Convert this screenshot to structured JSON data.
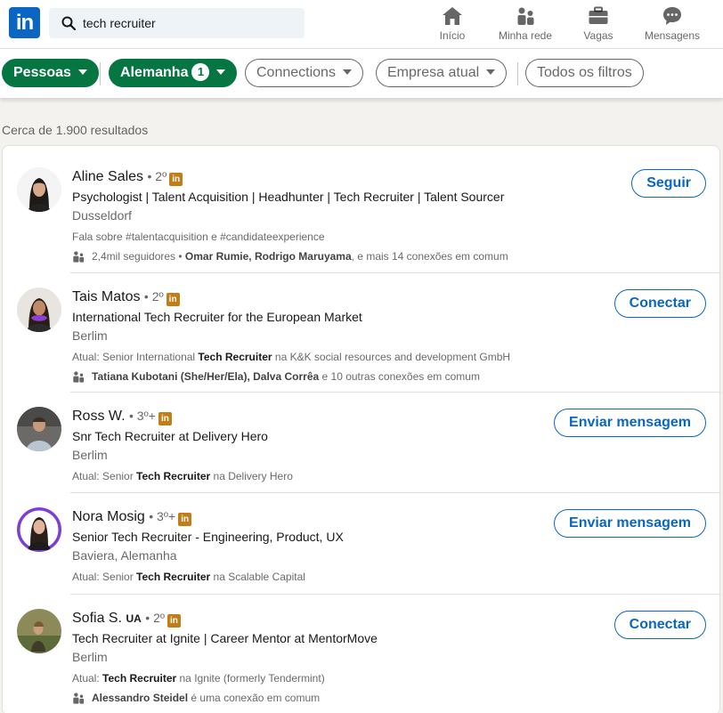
{
  "nav": {
    "logo_text": "in",
    "search_value": "tech recruiter",
    "items": [
      {
        "label": "Início",
        "icon": "home-icon"
      },
      {
        "label": "Minha rede",
        "icon": "network-icon"
      },
      {
        "label": "Vagas",
        "icon": "briefcase-icon"
      },
      {
        "label": "Mensagens",
        "icon": "messaging-icon"
      }
    ]
  },
  "filters": {
    "people": "Pessoas",
    "location": "Alemanha",
    "location_count": "1",
    "connections": "Connections",
    "company": "Empresa atual",
    "all_filters": "Todos os filtros"
  },
  "results_count": "Cerca de 1.900 resultados",
  "results": [
    {
      "name": "Aline Sales",
      "degree": "• 2º",
      "headline": "Psychologist | Talent Acquisition | Headhunter | Tech Recruiter | Talent Sourcer",
      "location": "Dusseldorf",
      "summary": "Fala sobre #talentacquisition e #candidateexperience",
      "insight_pre": "2,4mil seguidores • ",
      "insight_bold": "Omar Rumie, Rodrigo Maruyama",
      "insight_post": ", e mais 14 conexões em comum",
      "action": "Seguir"
    },
    {
      "name": "Tais Matos",
      "degree": "• 2º",
      "headline": "International Tech Recruiter for the European Market",
      "location": "Berlim",
      "summary_pre": "Atual: Senior International ",
      "summary_bold": "Tech Recruiter",
      "summary_post": " na K&K social resources and development GmbH",
      "insight_bold": "Tatiana Kubotani (She/Her/Ela), Dalva Corrêa",
      "insight_post": " e 10 outras conexões em comum",
      "action": "Conectar"
    },
    {
      "name": "Ross W.",
      "degree": "• 3º+",
      "headline": "Snr Tech Recruiter at Delivery Hero",
      "location": "Berlim",
      "summary_pre": "Atual: Senior ",
      "summary_bold": "Tech Recruiter",
      "summary_post": " na Delivery Hero",
      "action": "Enviar mensagem"
    },
    {
      "name": "Nora Mosig",
      "degree": "• 3º+",
      "headline": "Senior Tech Recruiter - Engineering, Product, UX",
      "location": "Baviera, Alemanha",
      "summary_pre": "Atual: Senior ",
      "summary_bold": "Tech Recruiter",
      "summary_post": " na Scalable Capital",
      "action": "Enviar mensagem"
    },
    {
      "name": "Sofia S.",
      "flag": "UA",
      "degree": "• 2º",
      "headline": "Tech Recruiter at Ignite | Career Mentor at MentorMove",
      "location": "Berlim",
      "summary_pre": "Atual: ",
      "summary_bold": "Tech Recruiter",
      "summary_post": " na Ignite (formerly Tendermint)",
      "insight_bold": "Alessandro Steidel",
      "insight_post": " é uma conexão em comum",
      "action": "Conectar"
    }
  ],
  "li_badge_text": "in",
  "colors": {
    "brand": "#0a66c2",
    "filter_active": "#057642",
    "premium_badge": "#c37d16"
  }
}
